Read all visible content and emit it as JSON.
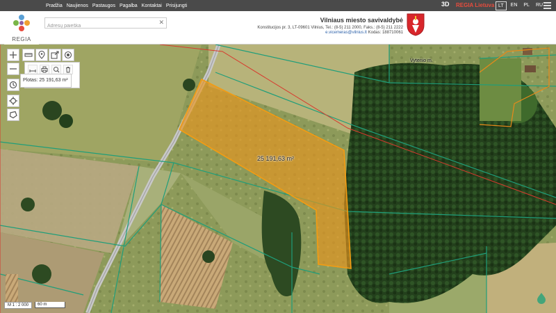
{
  "topbar": {
    "nav": [
      "Pradžia",
      "Naujienos",
      "Pastaugos",
      "Pagalba",
      "Kontaktai",
      "Prisijungti"
    ],
    "brand_3d": "3D",
    "brand_regia": "REGIA Lietuva",
    "languages": [
      "LT",
      "EN",
      "PL",
      "RU"
    ],
    "active_language": "LT",
    "icon": "hamburger-menu-icon"
  },
  "header": {
    "logo_text": "REGIA",
    "search": {
      "placeholder": "Adresų paieška",
      "value": ""
    },
    "municipality": {
      "name": "Vilniaus miesto savivaldybė",
      "address": "Konstitucijos pr. 3, LT-09601 Vilnius, Tel.: (8-5) 211 2000, Faks.: (8-5) 211 2222",
      "email": "e.vicemeras@vilnius.lt",
      "code": "Kodas: 188710061"
    },
    "coat_of_arms_icon": "vilnius-coat-of-arms-icon"
  },
  "map": {
    "area_label": "25 191,63 m²",
    "road_label": "Vytenio m.",
    "tools": {
      "zoom_in": "zoom-in-icon",
      "zoom_out": "zoom-out-icon",
      "history": "history-icon",
      "locate": "locate-icon",
      "shapes": "polygon-icon",
      "row1": [
        "ruler-icon",
        "pin-icon",
        "share-icon",
        "record-icon"
      ],
      "row2": [
        "measure-line-icon",
        "print-icon",
        "search-area-icon",
        "trash-icon"
      ]
    },
    "measure_result": "Plotas: 25 191,63 m²",
    "scale_ratio": "M 1 : 2 000",
    "scale_bar": "60 m"
  },
  "colors": {
    "topbar": "#4a4a4a",
    "accent_red": "#e84c3d",
    "parcel_fill": "#e8951f",
    "parcel_stroke": "#f39c12",
    "boundary_green": "#1f9e7a",
    "boundary_red": "#d83a2e"
  }
}
